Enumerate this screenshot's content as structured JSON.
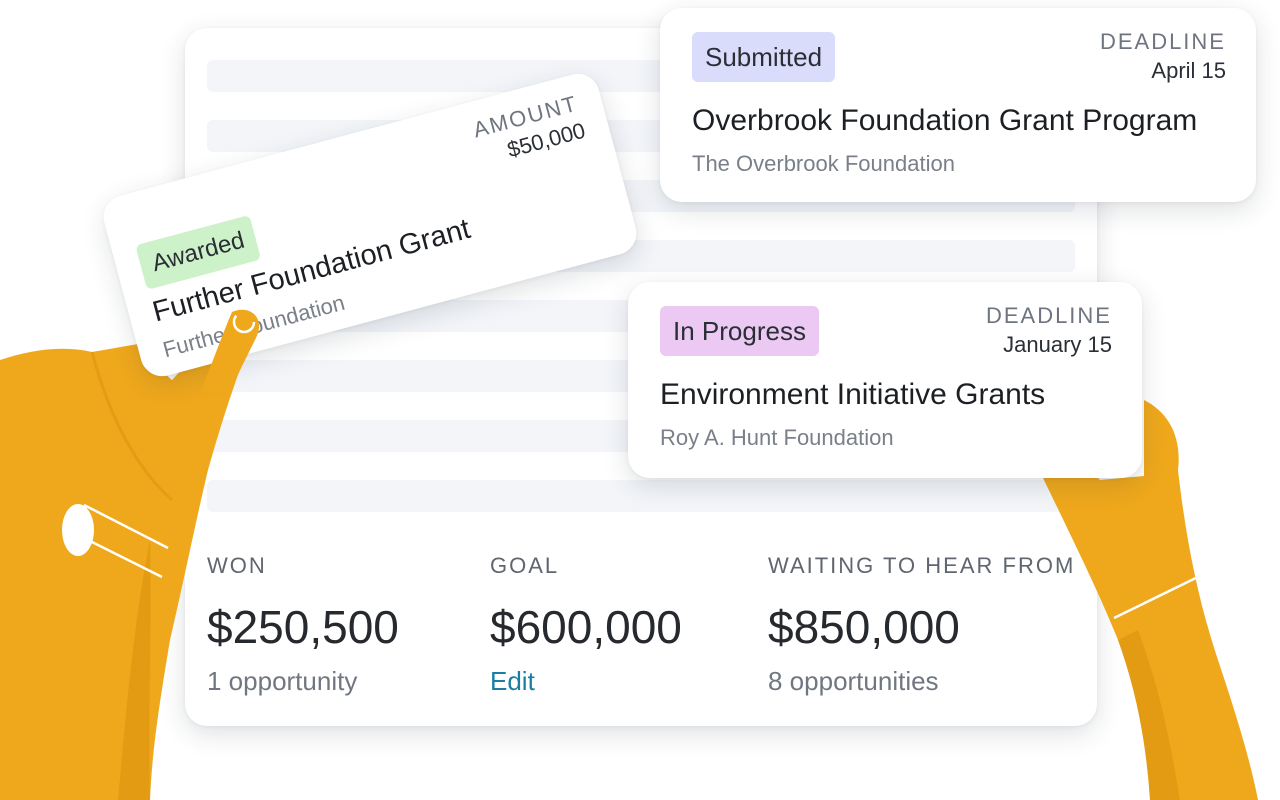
{
  "cards": {
    "submitted": {
      "status": "Submitted",
      "meta_label": "DEADLINE",
      "meta_value": "April 15",
      "title": "Overbrook Foundation Grant Program",
      "org": "The Overbrook Foundation"
    },
    "in_progress": {
      "status": "In Progress",
      "meta_label": "DEADLINE",
      "meta_value": "January 15",
      "title": "Environment Initiative Grants",
      "org": "Roy A. Hunt Foundation"
    },
    "awarded": {
      "status": "Awarded",
      "meta_label": "AMOUNT",
      "meta_value": "$50,000",
      "title": "Further Foundation Grant",
      "org": "Further Foundation"
    }
  },
  "stats": {
    "won": {
      "label": "WON",
      "value": "$250,500",
      "sub": "1 opportunity"
    },
    "goal": {
      "label": "GOAL",
      "value": "$600,000",
      "link": "Edit"
    },
    "waiting": {
      "label": "WAITING TO HEAR FROM",
      "value": "$850,000",
      "sub": "8 opportunities"
    }
  },
  "colors": {
    "hand": "#efa81c",
    "hand_shadow": "#d98f0d",
    "badge_submitted": "#d9dcfb",
    "badge_in_progress": "#ecc9f3",
    "badge_awarded": "#cdf1c8",
    "link": "#1a7ea3"
  }
}
